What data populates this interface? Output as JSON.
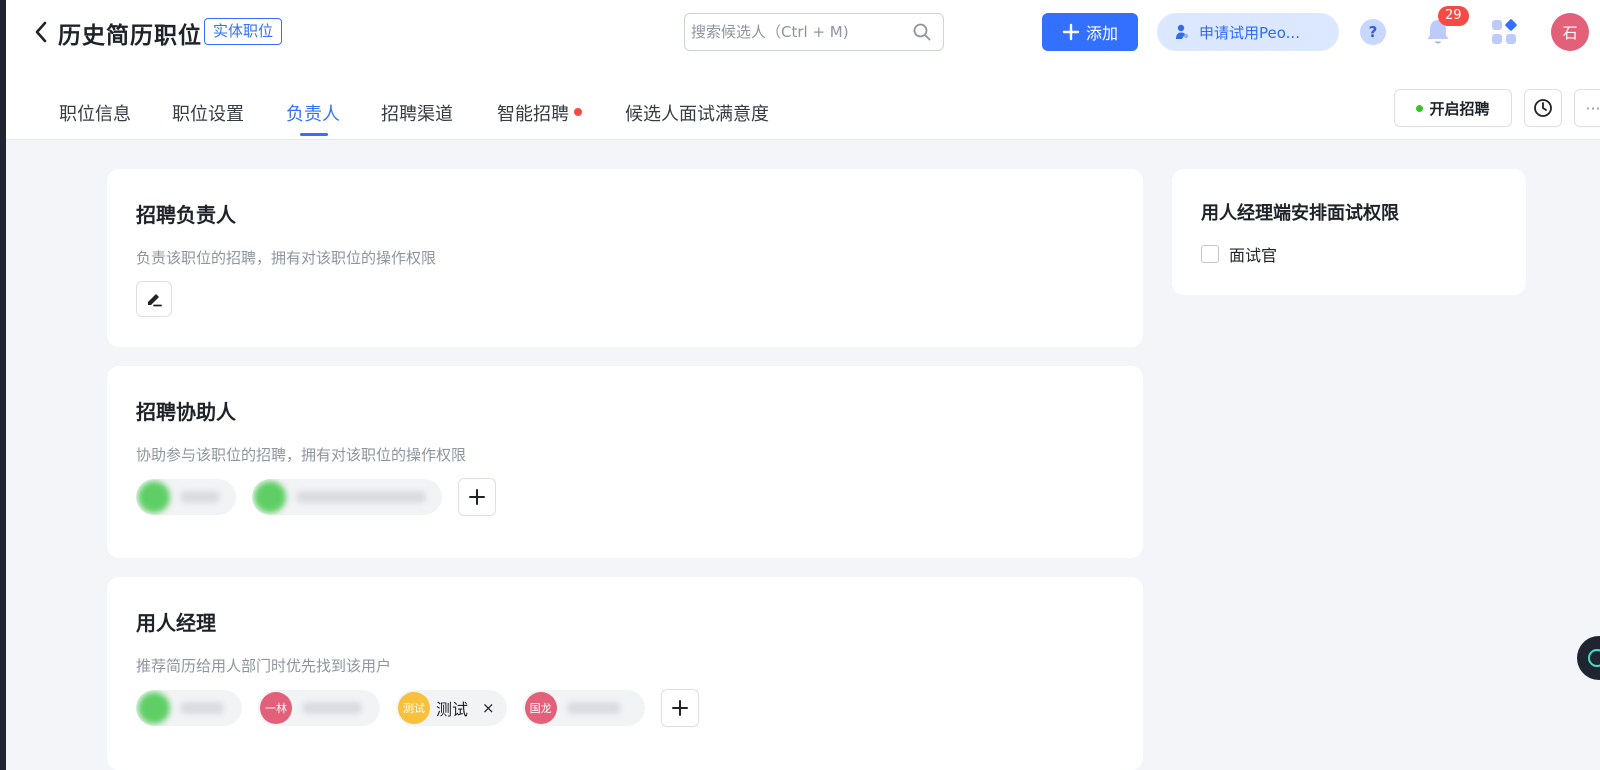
{
  "header": {
    "title": "历史简历职位",
    "tag": "实体职位",
    "search_placeholder": "搜索候选人（Ctrl + M)",
    "add_label": "添加",
    "trial_label": "申请试用Peo...",
    "help_label": "?",
    "notification_count": "29",
    "user_avatar": "石"
  },
  "tabs": [
    {
      "label": "职位信息"
    },
    {
      "label": "职位设置"
    },
    {
      "label": "负责人"
    },
    {
      "label": "招聘渠道"
    },
    {
      "label": "智能招聘"
    },
    {
      "label": "候选人面试满意度"
    }
  ],
  "actions": {
    "start_label": "开启招聘",
    "more_label": "···"
  },
  "sections": {
    "owner": {
      "title": "招聘负责人",
      "desc": "负责该职位的招聘，拥有对该职位的操作权限"
    },
    "assistant": {
      "title": "招聘协助人",
      "desc": "协助参与该职位的招聘，拥有对该职位的操作权限"
    },
    "manager": {
      "title": "用人经理",
      "desc": "推荐简历给用人部门时优先找到该用户",
      "members": [
        {
          "avatar": ""
        },
        {
          "avatar": "一林"
        },
        {
          "avatar": "测试",
          "name": "测试"
        },
        {
          "avatar": "国龙"
        }
      ],
      "remove_label": "×"
    },
    "permission": {
      "title": "用人经理端安排面试权限",
      "checkbox_label": "面试官"
    }
  },
  "colors": {
    "primary": "#3370ff",
    "badge": "#f54a45",
    "avatar_green": "#5fcf65",
    "avatar_pink": "#e2607a",
    "avatar_yellow": "#f7c13c"
  }
}
